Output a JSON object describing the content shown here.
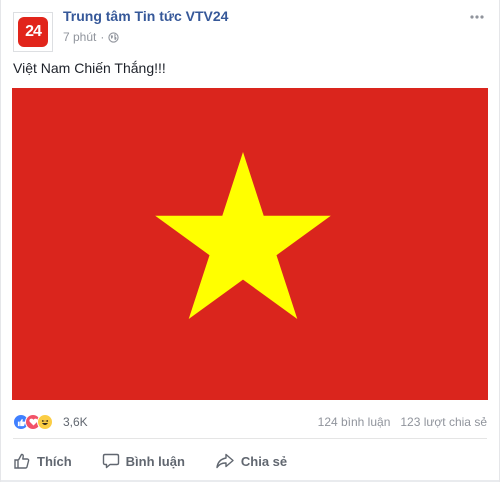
{
  "post": {
    "page_name": "Trung tâm Tin tức VTV24",
    "avatar_text": "24",
    "time": "7 phút",
    "separator": "·",
    "caption": "Việt Nam Chiến Thắng!!!"
  },
  "stats": {
    "reaction_count": "3,6K",
    "comments": "124 bình luận",
    "shares": "123 lượt chia sẻ"
  },
  "actions": {
    "like": "Thích",
    "comment": "Bình luận",
    "share": "Chia sẻ"
  },
  "colors": {
    "flag_red": "#da251d",
    "flag_star": "#ffff00",
    "link_blue": "#365899",
    "avatar_red": "#e1251b",
    "like_blue": "#4080ff",
    "love_red": "#f25268",
    "haha_yellow": "#fbcd44"
  },
  "icons": [
    "globe-icon",
    "more-options-icon",
    "like-reaction-icon",
    "love-reaction-icon",
    "haha-reaction-icon",
    "thumbs-up-icon",
    "comment-icon",
    "share-icon"
  ]
}
